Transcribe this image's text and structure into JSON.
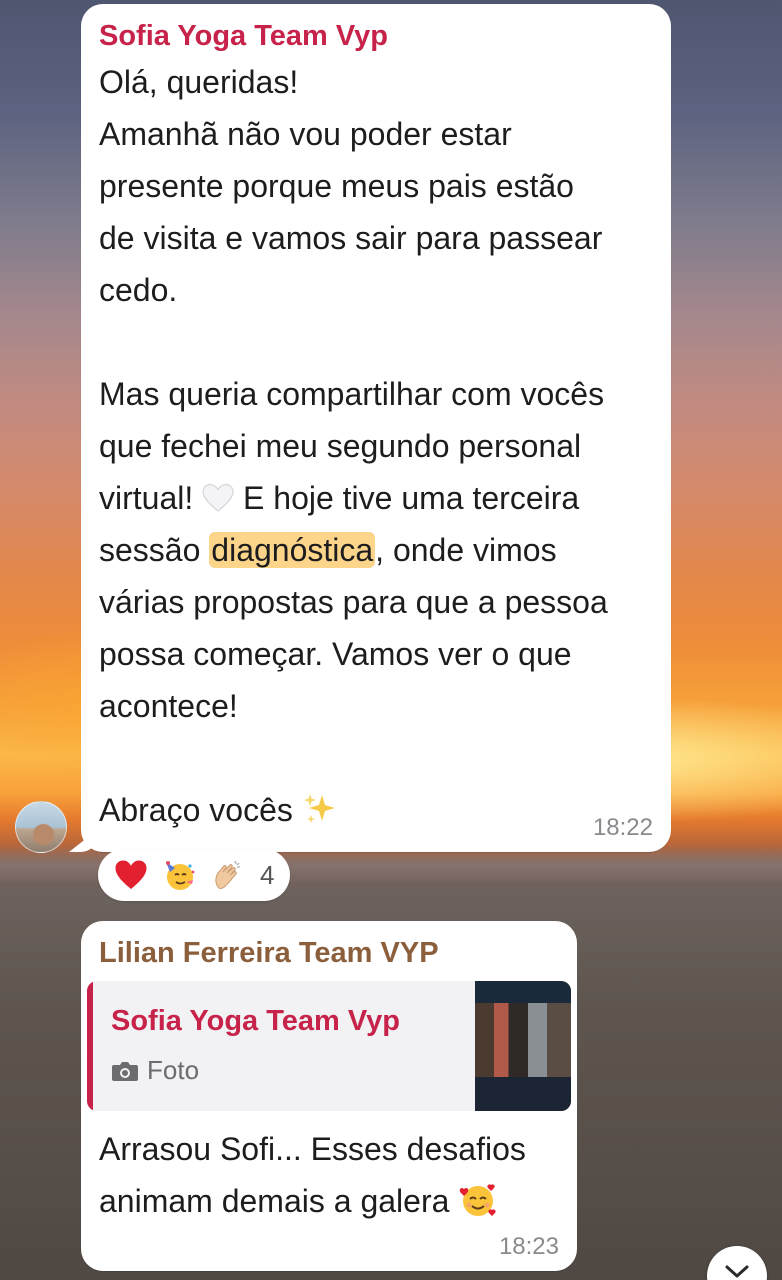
{
  "messages": [
    {
      "sender": "Sofia Yoga Team Vyp",
      "text_part1": "Olá, queridas!\nAmanhã não vou poder estar\npresente porque meus pais estão\nde visita e vamos sair para passear\ncedo.\n\nMas queria compartilhar com vocês\nque fechei meu segundo personal\nvirtual! ",
      "text_part2": " E hoje tive uma terceira\nsessão ",
      "highlight": "diagnóstica",
      "text_part3": ", onde vimos\nvárias propostas para que a pessoa\npossa começar. Vamos ver o que\nacontece!\n\nAbraço vocês ",
      "time": "18:22",
      "reactions": {
        "icons": [
          "red-heart",
          "partying-face",
          "clapping-hands"
        ],
        "count": "4"
      }
    },
    {
      "sender": "Lilian Ferreira Team VYP",
      "quote": {
        "sender": "Sofia Yoga Team Vyp",
        "type_label": "Foto"
      },
      "text": "Arrasou Sofi... Esses desafios\nanimam demais a galera ",
      "time": "18:23"
    }
  ],
  "colors": {
    "sofia": "#c7234a",
    "lilian": "#8b5e3c",
    "highlight": "#fcd48a"
  }
}
